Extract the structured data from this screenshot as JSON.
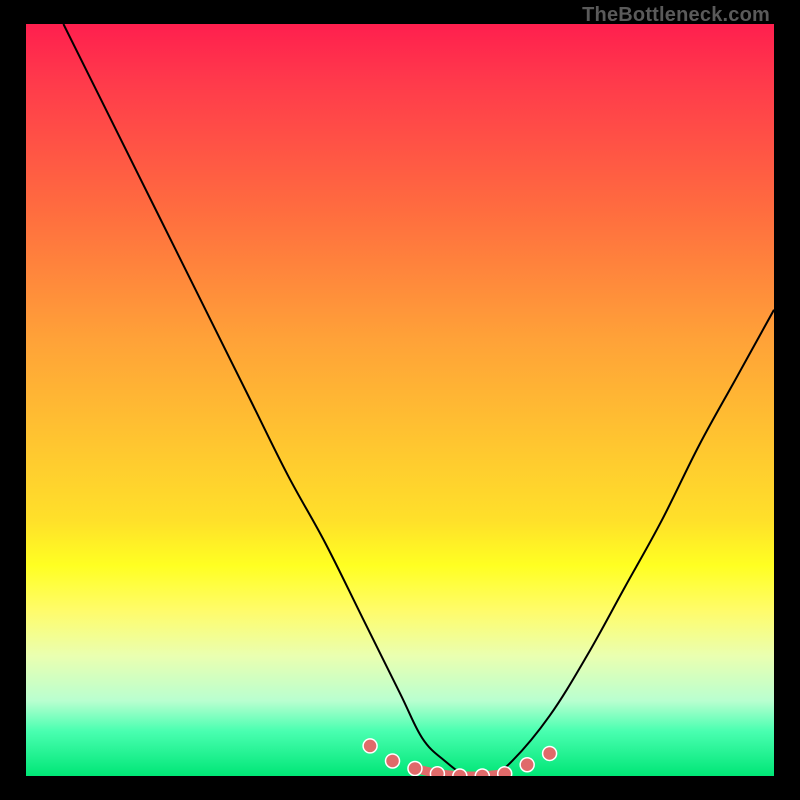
{
  "attribution": "TheBottleneck.com",
  "colors": {
    "marker": "#e06a6a",
    "curve": "#000000",
    "gradient_top": "#ff1f4e",
    "gradient_bottom": "#00e676"
  },
  "chart_data": {
    "type": "line",
    "title": "",
    "xlabel": "",
    "ylabel": "",
    "xlim": [
      0,
      100
    ],
    "ylim": [
      0,
      100
    ],
    "series": [
      {
        "name": "bottleneck-curve",
        "x": [
          5,
          10,
          15,
          20,
          25,
          30,
          35,
          40,
          45,
          50,
          53,
          56,
          59,
          62,
          65,
          70,
          75,
          80,
          85,
          90,
          95,
          100
        ],
        "values": [
          100,
          90,
          80,
          70,
          60,
          50,
          40,
          31,
          21,
          11,
          5,
          2,
          0,
          0,
          2,
          8,
          16,
          25,
          34,
          44,
          53,
          62
        ]
      }
    ],
    "markers": {
      "x": [
        46,
        49,
        52,
        55,
        58,
        61,
        64,
        67,
        70
      ],
      "values": [
        4.0,
        2.0,
        1.0,
        0.3,
        0.0,
        0.0,
        0.3,
        1.5,
        3.0
      ]
    }
  }
}
